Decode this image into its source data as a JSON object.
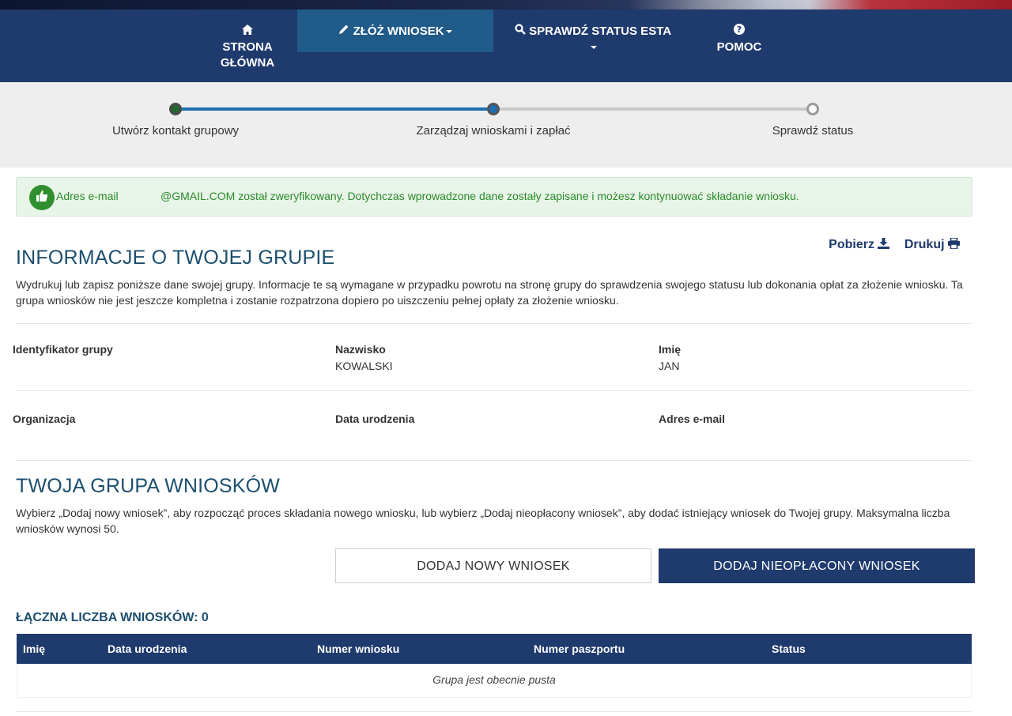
{
  "nav": {
    "home": {
      "icon": "home-icon",
      "line1": "STRONA",
      "line2": "GŁÓWNA"
    },
    "apply": {
      "icon": "pencil-icon",
      "label": "ZŁÓŻ WNIOSEK"
    },
    "status": {
      "icon": "search-icon",
      "label": "SPRAWDŹ STATUS ESTA"
    },
    "help": {
      "icon": "question-icon",
      "label": "POMOC"
    }
  },
  "progress": {
    "steps": [
      "Utwórz kontakt grupowy",
      "Zarządzaj wnioskami i zapłać",
      "Sprawdź status"
    ],
    "current_step": 2
  },
  "alert": {
    "icon": "thumbs-up-icon",
    "label": "Adres e-mail",
    "message": "@GMAIL.COM został zweryfikowany. Dotychczas wprowadzone dane zostały zapisane i możesz kontynuować składanie wniosku."
  },
  "group_info": {
    "title": "INFORMACJE O TWOJEJ GRUPIE",
    "description": "Wydrukuj lub zapisz poniższe dane swojej grupy. Informacje te są wymagane w przypadku powrotu na stronę grupy do sprawdzenia swojego statusu lub dokonania opłat za złożenie wniosku. Ta grupa wniosków nie jest jeszcze kompletna i zostanie rozpatrzona dopiero po uiszczeniu pełnej opłaty za złożenie wniosku.",
    "download_label": "Pobierz",
    "print_label": "Drukuj",
    "fields": {
      "group_id": {
        "label": "Identyfikator grupy",
        "value": ""
      },
      "surname": {
        "label": "Nazwisko",
        "value": "KOWALSKI"
      },
      "first_name": {
        "label": "Imię",
        "value": "JAN"
      },
      "organization": {
        "label": "Organizacja",
        "value": ""
      },
      "birth_date": {
        "label": "Data urodzenia",
        "value": ""
      },
      "email": {
        "label": "Adres e-mail",
        "value": ""
      }
    }
  },
  "applications": {
    "title": "TWOJA GRUPA WNIOSKÓW",
    "description": "Wybierz „Dodaj nowy wniosek”, aby rozpocząć proces składania nowego wniosku, lub wybierz „Dodaj nieopłacony wniosek”, aby dodać istniejący wniosek do Twojej grupy. Maksymalna liczba wniosków wynosi 50.",
    "add_new_label": "DODAJ NOWY WNIOSEK",
    "add_unpaid_label": "DODAJ NIEOPŁACONY WNIOSEK",
    "count_label": "ŁĄCZNA LICZBA WNIOSKÓW: 0",
    "table": {
      "headers": [
        "Imię",
        "Data urodzenia",
        "Numer wniosku",
        "Numer paszportu",
        "Status"
      ],
      "empty_text": "Grupa jest obecnie pusta"
    }
  },
  "colors": {
    "navbar": "#1f3a6d",
    "nav_active": "#205b8a",
    "heading": "#1c4f6e",
    "success": "#2c8a2c"
  }
}
